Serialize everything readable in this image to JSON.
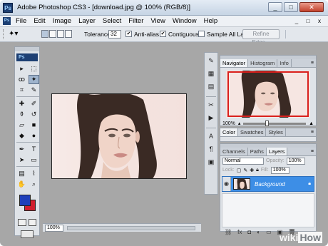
{
  "app": {
    "logo": "Ps",
    "title": "Adobe Photoshop CS3 - [download.jpg @ 100% (RGB/8)]",
    "window_buttons": [
      "_",
      "□",
      "✕"
    ]
  },
  "menu": {
    "items": [
      "File",
      "Edit",
      "Image",
      "Layer",
      "Select",
      "Filter",
      "View",
      "Window",
      "Help"
    ],
    "doc_buttons": [
      "_",
      "□",
      "x"
    ]
  },
  "options": {
    "tool_icon": "magic-wand-icon",
    "tolerance_label": "Tolerance:",
    "tolerance_value": "32",
    "antialias_label": "Anti-alias",
    "antialias_checked": true,
    "contiguous_label": "Contiguous",
    "contiguous_checked": true,
    "sample_all_label": "Sample All Layers",
    "sample_all_checked": false,
    "refine_edge_label": "Refine Edge..."
  },
  "toolbox": {
    "logo": "Ps",
    "foreground_color": "#1f3fba",
    "background_color": "#d11f2e"
  },
  "status": {
    "zoom": "100%"
  },
  "navigator": {
    "tabs": [
      "Navigator",
      "Histogram",
      "Info"
    ],
    "zoom": "100%",
    "view_rect_color": "#d9201c"
  },
  "color_panel": {
    "tabs": [
      "Color",
      "Swatches",
      "Styles"
    ]
  },
  "layers_panel": {
    "tabs": [
      "Channels",
      "Paths",
      "Layers"
    ],
    "blend_mode": "Normal",
    "opacity_label": "Opacity:",
    "opacity_value": "100%",
    "lock_label": "Lock:",
    "fill_label": "Fill:",
    "fill_value": "100%",
    "layer_name": "Background",
    "selected_color": "#3d8ee6"
  },
  "watermark": {
    "wiki": "wiki",
    "how": "How"
  }
}
